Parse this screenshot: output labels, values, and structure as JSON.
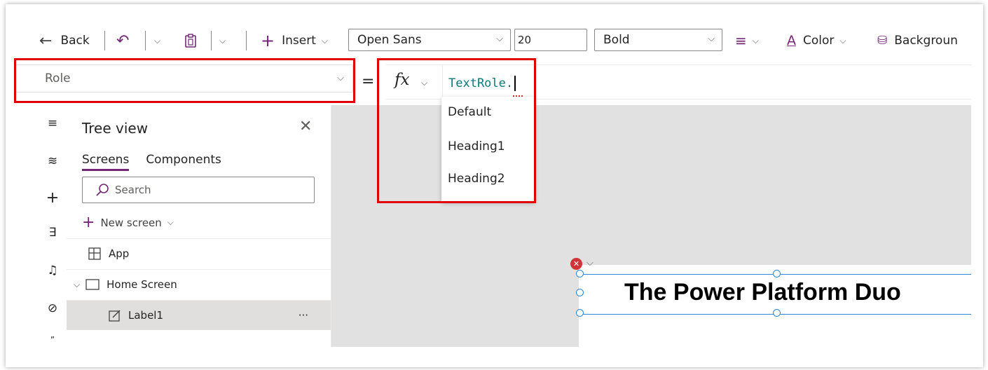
{
  "toolbar": {
    "back_label": "Back",
    "insert_label": "Insert",
    "font_name": "Open Sans",
    "font_size": "20",
    "font_weight": "Bold",
    "color_label": "Color",
    "background_label": "Backgroun"
  },
  "formula_bar": {
    "property": "Role",
    "equals": "=",
    "fx": "fx",
    "formula_text": "TextRole.",
    "suggestions": [
      "Default",
      "Heading1",
      "Heading2"
    ]
  },
  "tree_view": {
    "title": "Tree view",
    "tabs": [
      "Screens",
      "Components"
    ],
    "search_placeholder": "Search",
    "new_screen_label": "New screen",
    "items": [
      {
        "label": "App"
      },
      {
        "label": "Home Screen"
      },
      {
        "label": "Label1"
      }
    ],
    "more": "···"
  },
  "canvas": {
    "label_text": "The Power Platform Duo",
    "error_mark": "✕"
  },
  "colors": {
    "accent": "#742774",
    "highlight_box": "#e00000",
    "selection": "#2b88d8",
    "formula_text": "#0b7a7a"
  }
}
